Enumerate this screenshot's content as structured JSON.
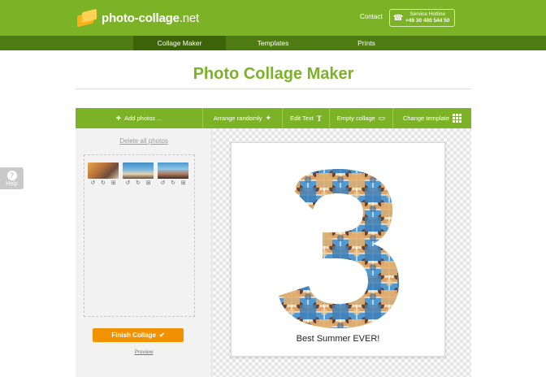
{
  "header": {
    "logo_name": "photo-collage",
    "logo_tld": ".net",
    "contact": "Contact",
    "hotline_label": "Service Hotline",
    "hotline_number": "+49 30 400 544 50"
  },
  "nav": {
    "items": [
      {
        "label": "Collage Maker",
        "active": true
      },
      {
        "label": "Templates",
        "active": false
      },
      {
        "label": "Prints",
        "active": false
      }
    ]
  },
  "page_title": "Photo Collage Maker",
  "toolbar": {
    "add_photos": "Add photos ...",
    "arrange_randomly": "Arrange randomly",
    "edit_text": "Edit Text",
    "empty_collage": "Empty collage",
    "change_template": "Change template"
  },
  "photos_panel": {
    "delete_all": "Delete all photos",
    "thumbnails": [
      {
        "icon": "photo-thumbnail"
      },
      {
        "icon": "photo-thumbnail"
      },
      {
        "icon": "photo-thumbnail"
      }
    ],
    "finish_button": "Finish Collage",
    "preview_link": "Preview"
  },
  "collage": {
    "template_shape": "3",
    "caption": "Best Summer EVER!"
  },
  "help_tab": "Help",
  "colors": {
    "brand_green": "#7cb226",
    "nav_dark_green": "#4e7b12",
    "finish_orange": "#f39200",
    "title_green": "#7cb226"
  }
}
